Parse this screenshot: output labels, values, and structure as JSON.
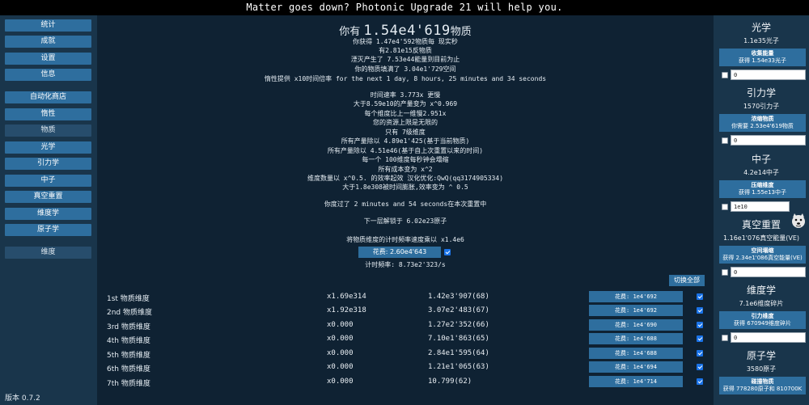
{
  "top_bar": {
    "message": "Matter goes down? Photonic Upgrade 21 will help you."
  },
  "sidebar": {
    "items": [
      {
        "label": "统计"
      },
      {
        "label": "成就"
      },
      {
        "label": "设置"
      },
      {
        "label": "信息"
      },
      {
        "label": "自动化商店"
      },
      {
        "label": "惰性"
      },
      {
        "label": "物质"
      },
      {
        "label": "光学"
      },
      {
        "label": "引力学"
      },
      {
        "label": "中子"
      },
      {
        "label": "真空重置"
      },
      {
        "label": "维度学"
      },
      {
        "label": "原子学"
      },
      {
        "label": "维度"
      }
    ],
    "version": "版本 0.7.2"
  },
  "main": {
    "amount_prefix": "你有",
    "amount_value": "1.54e4'619",
    "amount_suffix": "物质",
    "info_lines": [
      "你获得 1.47e4'592物质每 现实秒",
      "有2.81e15反物质",
      "湮灭产生了 7.53e44能量到目前为止",
      "你的物质填满了 3.04e1'729空间",
      "惰性提供 x10时间倍率 for the next 1 day, 8 hours, 25 minutes and 34 seconds"
    ],
    "effect_lines": [
      "时间速率 3.773x 更慢",
      "大于8.59e10的产量变为 x^0.969",
      "每个维度比上一维慢2.951x",
      "您的资源上限是无限的",
      "只有 7级维度",
      "所有产量除以 4.89e1'425(基于当前物质)",
      "所有产量除以 4.51e46(基于自上次重置以来的时间)",
      "每一个 100维度每秒钟会塌缩",
      "所有成本变为 x^2",
      "维度数量以 x^0.5. 的效率起效 汉化优化:QwQ(qq3174905334)",
      "大于1.8e308被时间膨胀,效率变为 ^ 0.5"
    ],
    "time_line": "你度过了 2 minutes and 54 seconds在本次重置中",
    "unlock_line": "下一层解锁于 6.02e23原子",
    "tickspeed_line": "将物质维度的计时频率速度乘以 x1.4e6",
    "tickspeed_cost": "花费: 2.60e4'643",
    "tickspeed_freq": "计时频率: 8.73e2'323/s",
    "toggle_all": "切换全部",
    "dimensions": [
      {
        "name": "1st 物质维度",
        "mult": "x1.69e314",
        "amount": "1.42e3'907(68)",
        "cost": "花费: 1e4'692"
      },
      {
        "name": "2nd 物质维度",
        "mult": "x1.92e318",
        "amount": "3.07e2'483(67)",
        "cost": "花费: 1e4'692"
      },
      {
        "name": "3rd 物质维度",
        "mult": "x0.000",
        "amount": "1.27e2'352(66)",
        "cost": "花费: 1e4'690"
      },
      {
        "name": "4th 物质维度",
        "mult": "x0.000",
        "amount": "7.10e1'863(65)",
        "cost": "花费: 1e4'688"
      },
      {
        "name": "5th 物质维度",
        "mult": "x0.000",
        "amount": "2.84e1'595(64)",
        "cost": "花费: 1e4'688"
      },
      {
        "name": "6th 物质维度",
        "mult": "x0.000",
        "amount": "1.21e1'065(63)",
        "cost": "花费: 1e4'694"
      },
      {
        "name": "7th 物质维度",
        "mult": "x0.000",
        "amount": "10.799(62)",
        "cost": "花费: 1e4'714"
      }
    ]
  },
  "right_panel": {
    "sections": [
      {
        "title": "光学",
        "amount": "1.1e35光子",
        "btn_title": "收集能量",
        "btn_text": "获得 1.54e33光子",
        "input": "0",
        "checked": false
      },
      {
        "title": "引力学",
        "amount": "1570引力子",
        "btn_title": "浓缩物质",
        "btn_text": "你需要 2.53e4'619物质",
        "input": "0",
        "checked": false
      },
      {
        "title": "中子",
        "amount": "4.2e14中子",
        "btn_title": "压缩维度",
        "btn_text": "获得 1.55e13中子",
        "input": "1e10",
        "checked": false
      },
      {
        "title": "真空重置",
        "amount": "1.16e1'076真空能量(VE)",
        "btn_title": "空间塌缩",
        "btn_text": "获得 2.34e1'086真空能量(VE)",
        "input": "0",
        "checked": false
      },
      {
        "title": "维度学",
        "amount": "7.1e6维度碎片",
        "btn_title": "引力维度",
        "btn_text": "获得 670949维度碎片",
        "input": "0",
        "checked": false
      },
      {
        "title": "原子学",
        "amount": "3580原子",
        "btn_title": "碰撞物质",
        "btn_text": "获得 778280原子和 810700K",
        "input": "",
        "checked": false
      }
    ]
  },
  "colors": {
    "accent_button": "#2e6e9e",
    "sidebar_bg": "#19354b",
    "main_bg": "#0f2233"
  },
  "icons": {
    "mascot": "doge-face-icon",
    "checkbox": "checkbox-icon"
  }
}
